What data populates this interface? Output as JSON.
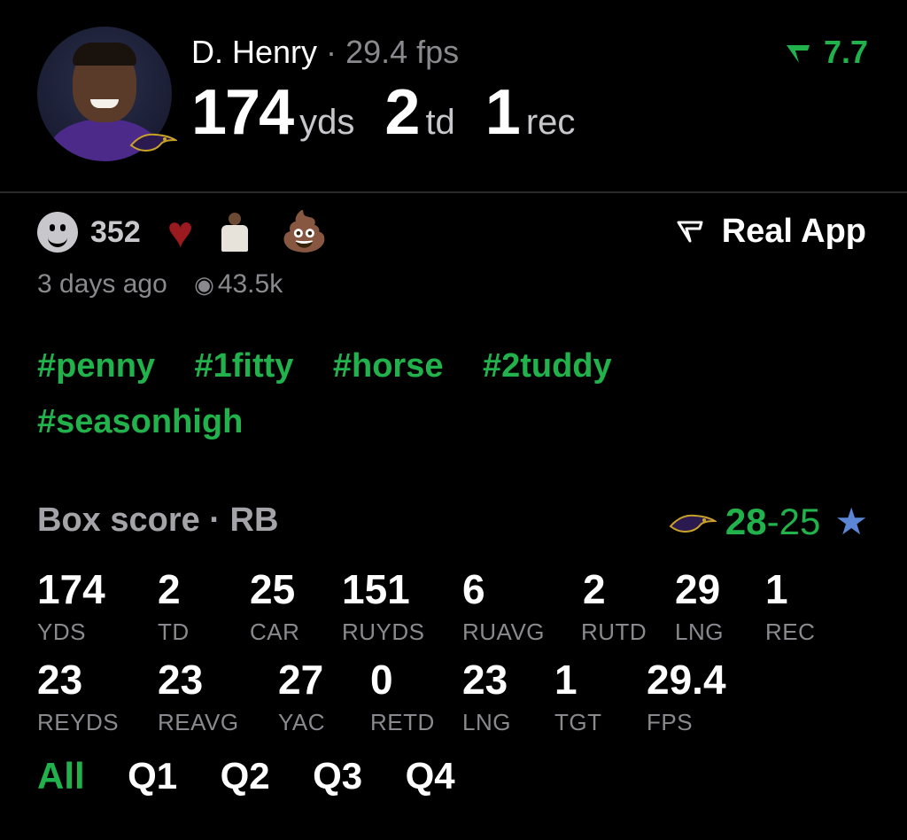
{
  "player": {
    "name": "D. Henry",
    "separator": "·",
    "fps": "29.4 fps",
    "yds_value": "174",
    "yds_unit": "yds",
    "td_value": "2",
    "td_unit": "td",
    "rec_value": "1",
    "rec_unit": "rec",
    "avatar_icon": "player-headshot",
    "team_icon": "ravens-logo-icon"
  },
  "rating": {
    "icon": "real-logo-icon",
    "value": "7.7",
    "color": "#22b24c"
  },
  "reactions": {
    "count": "352",
    "emoji_heart": "♥",
    "emoji_poop": "💩"
  },
  "brand": {
    "label": "Real App",
    "arrow": "⛛"
  },
  "meta": {
    "time": "3 days ago",
    "eye": "👁",
    "views": "43.5k"
  },
  "hashtags": [
    "#penny",
    "#1fitty",
    "#horse",
    "#2tuddy",
    "#seasonhigh"
  ],
  "box_score": {
    "title": "Box score · RB",
    "home_score": "28",
    "dash": "-",
    "away_score": "25",
    "away_icon": "★",
    "row1": [
      {
        "value": "174",
        "label": "YDS"
      },
      {
        "value": "2",
        "label": "TD"
      },
      {
        "value": "25",
        "label": "CAR"
      },
      {
        "value": "151",
        "label": "RUYDS"
      },
      {
        "value": "6",
        "label": "RUAVG"
      },
      {
        "value": "2",
        "label": "RUTD"
      },
      {
        "value": "29",
        "label": "LNG"
      },
      {
        "value": "1",
        "label": "REC"
      }
    ],
    "row2": [
      {
        "value": "23",
        "label": "REYDS"
      },
      {
        "value": "23",
        "label": "REAVG"
      },
      {
        "value": "27",
        "label": "YAC"
      },
      {
        "value": "0",
        "label": "RETD"
      },
      {
        "value": "23",
        "label": "LNG"
      },
      {
        "value": "1",
        "label": "TGT"
      },
      {
        "value": "29.4",
        "label": "FPS"
      }
    ]
  },
  "quarters": [
    "All",
    "Q1",
    "Q2",
    "Q3",
    "Q4"
  ],
  "colors": {
    "accent": "#22b24c",
    "muted": "#8a8a8e",
    "background": "#000000"
  }
}
